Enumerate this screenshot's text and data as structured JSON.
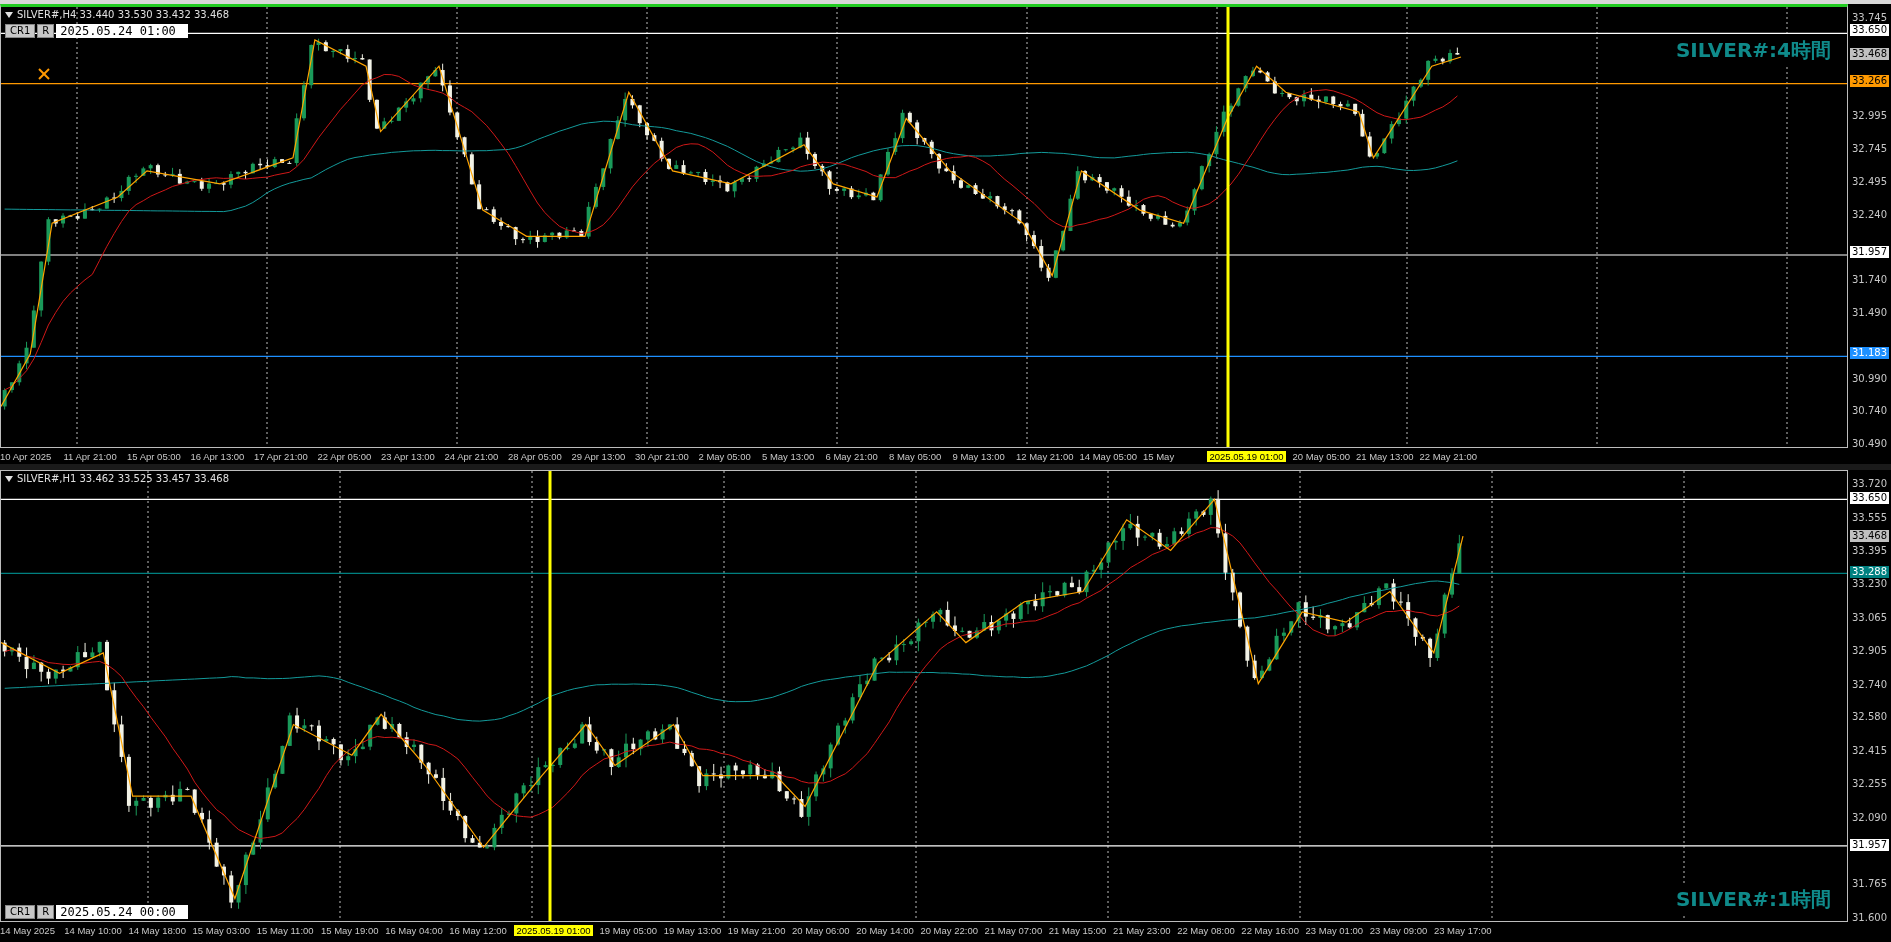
{
  "charts": [
    {
      "quote": "SILVER#,H4 33.440 33.530 33.432 33.468",
      "buttons": [
        "CR1",
        "R"
      ],
      "crosshair_time": "2025.05.24 01:00",
      "watermark": "SILVER#:4時間",
      "price_ticks": [
        "33.745",
        "32.995",
        "32.745",
        "32.495",
        "32.240",
        "31.740",
        "31.490",
        "30.990",
        "30.740",
        "30.490"
      ],
      "price_tags": [
        {
          "label": "33.650",
          "color": "#ffffff",
          "kind": "level"
        },
        {
          "label": "33.468",
          "color": "#c0c0c0",
          "kind": "bid"
        },
        {
          "label": "33.266",
          "color": "#ff9900",
          "kind": "level"
        },
        {
          "label": "31.957",
          "color": "#ffffff",
          "kind": "level"
        },
        {
          "label": "31.183",
          "color": "#1e90ff",
          "kind": "level"
        }
      ],
      "time_labels": [
        "10 Apr 2025",
        "11 Apr 21:00",
        "15 Apr 05:00",
        "16 Apr 13:00",
        "17 Apr 21:00",
        "22 Apr 05:00",
        "23 Apr 13:00",
        "24 Apr 21:00",
        "28 Apr 05:00",
        "29 Apr 13:00",
        "30 Apr 21:00",
        "2 May 05:00",
        "5 May 13:00",
        "6 May 21:00",
        "8 May 05:00",
        "9 May 13:00",
        "12 May 21:00",
        "14 May 05:00",
        "15 May"
      ],
      "cursor_time_tag": "2025.05.19 01:00",
      "time_labels_after": [
        "20 May 05:00",
        "21 May 13:00",
        "22 May 21:00"
      ]
    },
    {
      "quote": "SILVER#,H1 33.462 33.525 33.457 33.468",
      "buttons": [
        "CR1",
        "R"
      ],
      "crosshair_time": "2025.05.24 00:00",
      "watermark": "SILVER#:1時間",
      "price_ticks": [
        "33.720",
        "33.555",
        "33.395",
        "33.230",
        "33.065",
        "32.905",
        "32.740",
        "32.580",
        "32.415",
        "32.255",
        "32.090",
        "31.765",
        "31.600"
      ],
      "price_tags": [
        {
          "label": "33.650",
          "color": "#ffffff",
          "kind": "level"
        },
        {
          "label": "33.468",
          "color": "#c0c0c0",
          "kind": "bid"
        },
        {
          "label": "33.288",
          "color": "#008080",
          "kind": "level"
        },
        {
          "label": "31.957",
          "color": "#ffffff",
          "kind": "level"
        }
      ],
      "time_labels": [
        "14 May 2025",
        "14 May 10:00",
        "14 May 18:00",
        "15 May 03:00",
        "15 May 11:00",
        "15 May 19:00",
        "16 May 04:00",
        "16 May 12:00"
      ],
      "cursor_time_tag": "2025.05.19 01:00",
      "time_labels_after": [
        "19 May 05:00",
        "19 May 13:00",
        "19 May 21:00",
        "20 May 06:00",
        "20 May 14:00",
        "20 May 22:00",
        "21 May 07:00",
        "21 May 15:00",
        "21 May 23:00",
        "22 May 08:00",
        "22 May 16:00",
        "23 May 01:00",
        "23 May 09:00",
        "23 May 17:00"
      ]
    }
  ]
}
